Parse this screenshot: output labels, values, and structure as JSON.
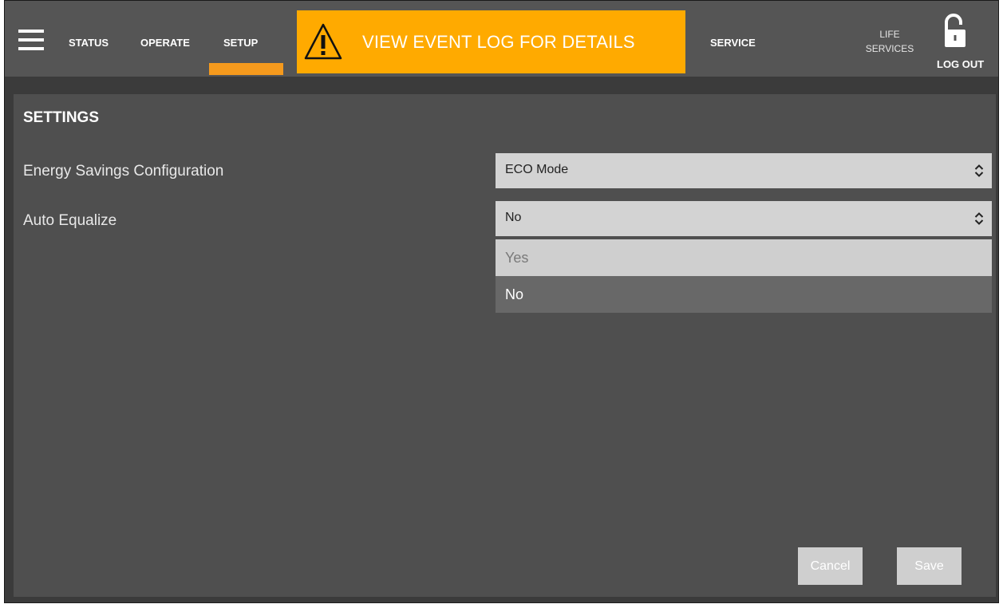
{
  "nav": {
    "tabs": [
      {
        "label": "STATUS"
      },
      {
        "label": "OPERATE"
      },
      {
        "label": "SETUP",
        "active": true
      }
    ],
    "alert": {
      "text": "VIEW EVENT LOG FOR DETAILS",
      "color": "#ffaa00"
    },
    "service_label": "SERVICE",
    "life_services": {
      "line1": "LIFE",
      "line2": "SERVICES"
    },
    "logout_label": "LOG OUT",
    "active_underline_color": "#f59a1d"
  },
  "settings": {
    "title": "SETTINGS",
    "rows": [
      {
        "label": "Energy Savings Configuration",
        "value": "ECO Mode"
      },
      {
        "label": "Auto Equalize",
        "value": "No"
      }
    ],
    "dropdown_options": [
      "Yes",
      "No"
    ],
    "dropdown_highlighted": "No"
  },
  "buttons": {
    "cancel": "Cancel",
    "save": "Save"
  }
}
